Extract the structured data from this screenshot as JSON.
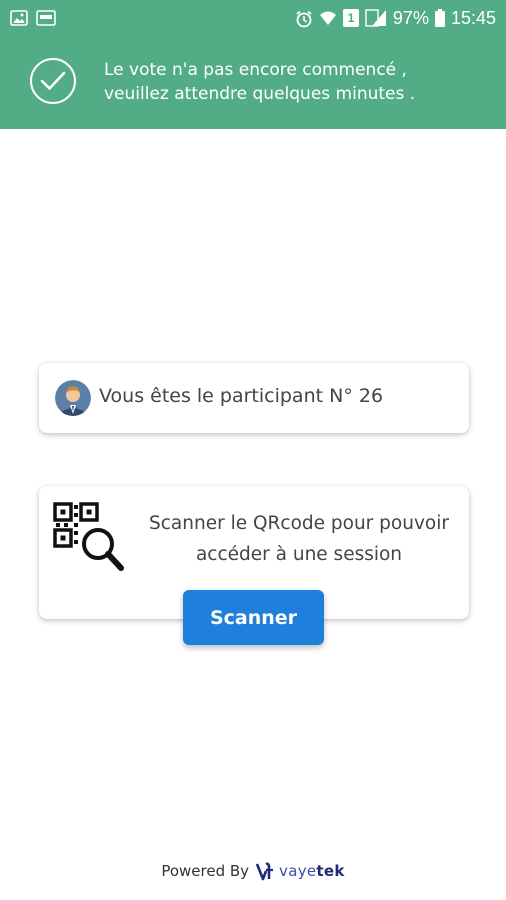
{
  "status_bar": {
    "battery": "97%",
    "time": "15:45",
    "sim_badge": "1",
    "left_icons": [
      "image-icon",
      "app-notification-icon"
    ],
    "right_icons": [
      "alarm-icon",
      "wifi-icon",
      "sim-icon",
      "signal-icon",
      "battery-icon"
    ]
  },
  "banner": {
    "message_line1": "Le vote n'a pas encore commencé ,",
    "message_line2": "veuillez attendre quelques minutes .",
    "icon": "check-circle-icon",
    "background": "#52ad86"
  },
  "participant": {
    "text": "Vous êtes le participant N° 26",
    "avatar_icon": "user-avatar-icon"
  },
  "scan": {
    "line1": "Scanner le QRcode pour pouvoir",
    "line2": "accéder à une session",
    "icon": "qr-search-icon",
    "button_label": "Scanner",
    "button_color": "#1e7fdc"
  },
  "footer": {
    "powered_by": "Powered By",
    "brand_part1": "vaye",
    "brand_part2": "tek"
  }
}
